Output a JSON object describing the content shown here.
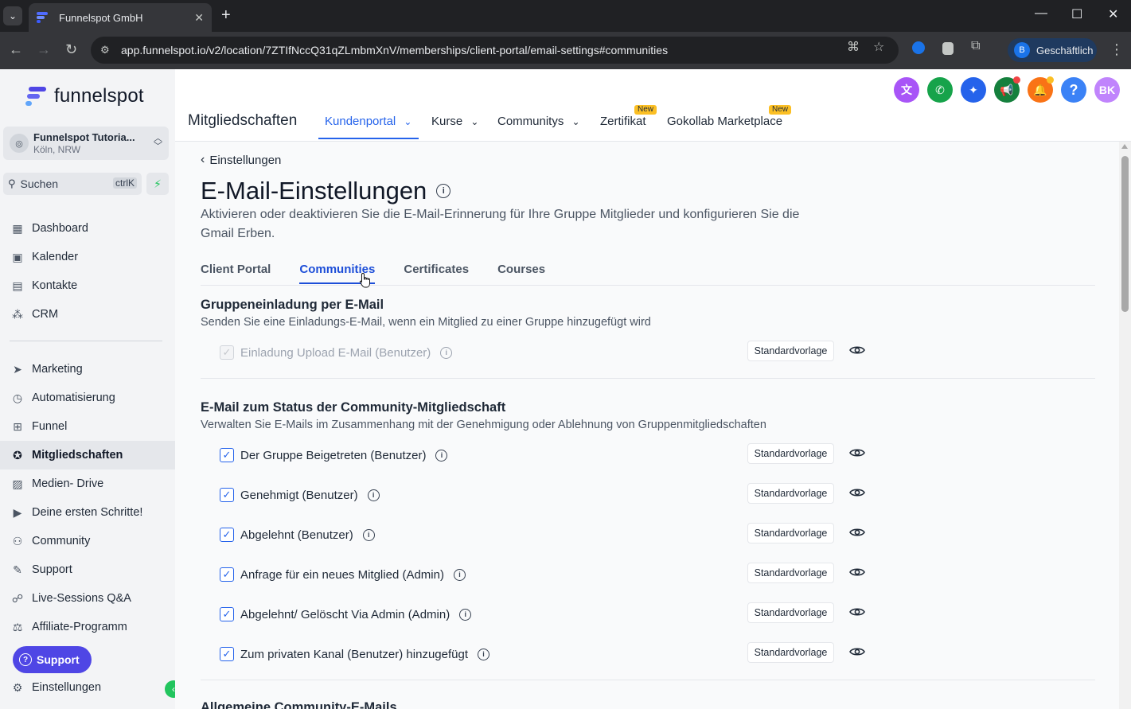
{
  "browser": {
    "tab_title": "Funnelspot GmbH",
    "url": "app.funnelspot.io/v2/location/7ZTIfNccQ31qZLmbmXnV/memberships/client-portal/email-settings#communities",
    "profile_initial": "B",
    "profile_label": "Geschäftlich"
  },
  "sidebar": {
    "logo_text": "funnelspot",
    "account_name": "Funnelspot Tutoria...",
    "account_location": "Köln, NRW",
    "search_label": "Suchen",
    "search_shortcut": "ctrlK",
    "items_top": [
      {
        "label": "Dashboard",
        "icon": "dashboard-icon"
      },
      {
        "label": "Kalender",
        "icon": "calendar-icon"
      },
      {
        "label": "Kontakte",
        "icon": "contacts-icon"
      },
      {
        "label": "CRM",
        "icon": "crm-icon"
      }
    ],
    "items_bottom": [
      {
        "label": "Marketing",
        "icon": "send-icon"
      },
      {
        "label": "Automatisierung",
        "icon": "automation-icon"
      },
      {
        "label": "Funnel",
        "icon": "funnel-icon"
      },
      {
        "label": "Mitgliedschaften",
        "icon": "award-icon",
        "active": true
      },
      {
        "label": "Medien- Drive",
        "icon": "image-icon"
      },
      {
        "label": "Deine ersten Schritte!",
        "icon": "play-icon"
      },
      {
        "label": "Community",
        "icon": "users-icon"
      },
      {
        "label": "Support",
        "icon": "wrench-icon"
      },
      {
        "label": "Live-Sessions Q&A",
        "icon": "chat-icon"
      },
      {
        "label": "Affiliate-Programm",
        "icon": "affiliate-icon"
      }
    ],
    "support_button": "Support",
    "settings_label": "Einstellungen"
  },
  "header": {
    "avatar_initials": "BK",
    "module_title": "Mitgliedschaften",
    "nav": [
      {
        "label": "Kundenportal",
        "dropdown": true,
        "active": true
      },
      {
        "label": "Kurse",
        "dropdown": true
      },
      {
        "label": "Communitys",
        "dropdown": true
      },
      {
        "label": "Zertifikat",
        "badge": "New"
      },
      {
        "label": "Gokollab Marketplace",
        "badge": "New"
      }
    ],
    "colors": {
      "translate": "#a855f7",
      "phone": "#16a34a",
      "magic": "#2563eb",
      "announce": "#15803d",
      "bell": "#f97316",
      "help": "#3b82f6",
      "avatar": "#c084fc"
    }
  },
  "content": {
    "back_label": "Einstellungen",
    "title": "E-Mail-Einstellungen",
    "subtitle": "Aktivieren oder deaktivieren Sie die E-Mail-Erinnerung für Ihre Gruppe Mitglieder und konfigurieren Sie die Gmail Erben.",
    "tabs": [
      "Client Portal",
      "Communities",
      "Certificates",
      "Courses"
    ],
    "active_tab": "Communities",
    "template_label": "Standardvorlage",
    "sections": [
      {
        "title": "Gruppeneinladung per E-Mail",
        "description": "Senden Sie eine Einladungs-E-Mail, wenn ein Mitglied zu einer Gruppe hinzugefügt wird",
        "rows": [
          {
            "label": "Einladung Upload E-Mail (Benutzer)",
            "checked": true,
            "disabled": true
          }
        ]
      },
      {
        "title": "E-Mail zum Status der Community-Mitgliedschaft",
        "description": "Verwalten Sie E-Mails im Zusammenhang mit der Genehmigung oder Ablehnung von Gruppenmitgliedschaften",
        "rows": [
          {
            "label": "Der Gruppe Beigetreten (Benutzer)",
            "checked": true
          },
          {
            "label": "Genehmigt (Benutzer)",
            "checked": true
          },
          {
            "label": "Abgelehnt (Benutzer)",
            "checked": true
          },
          {
            "label": "Anfrage für ein neues Mitglied (Admin)",
            "checked": true
          },
          {
            "label": "Abgelehnt/ Gelöscht Via Admin (Admin)",
            "checked": true
          },
          {
            "label": "Zum privaten Kanal (Benutzer) hinzugefügt",
            "checked": true
          }
        ]
      },
      {
        "title": "Allgemeine Community-E-Mails"
      }
    ]
  }
}
